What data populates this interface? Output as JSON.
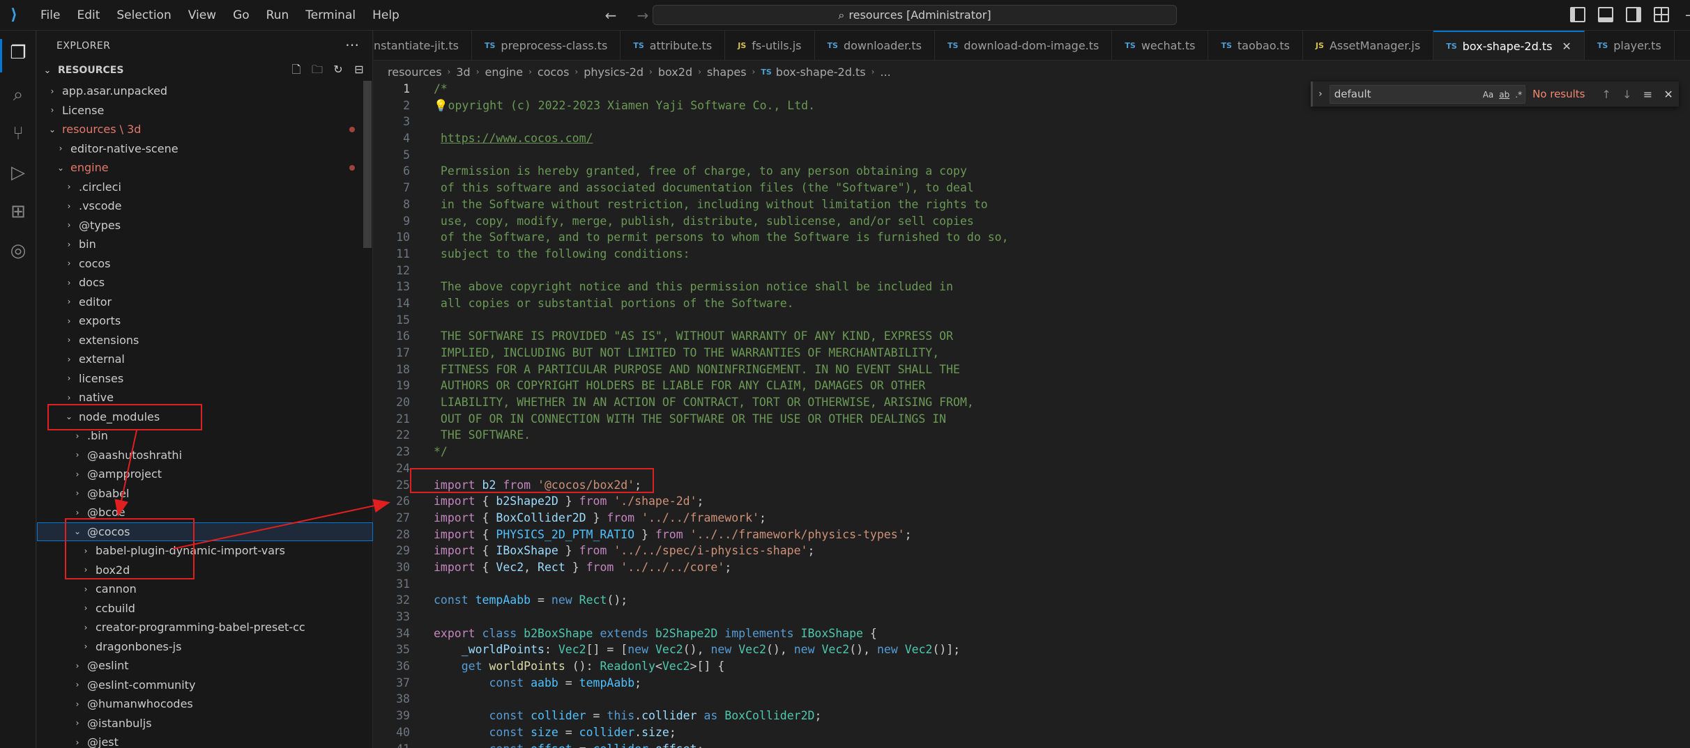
{
  "menu": [
    "File",
    "Edit",
    "Selection",
    "View",
    "Go",
    "Run",
    "Terminal",
    "Help"
  ],
  "command_center": "resources [Administrator]",
  "sidebar": {
    "title": "EXPLORER",
    "root": "RESOURCES",
    "items": [
      {
        "label": "app.asar.unpacked",
        "depth": 0,
        "state": "collapsed"
      },
      {
        "label": "License",
        "depth": 0,
        "state": "collapsed"
      },
      {
        "label": "resources \\ 3d",
        "depth": 0,
        "state": "expanded",
        "modified": true
      },
      {
        "label": "editor-native-scene",
        "depth": 1,
        "state": "collapsed"
      },
      {
        "label": "engine",
        "depth": 1,
        "state": "expanded",
        "modified": true
      },
      {
        "label": ".circleci",
        "depth": 2,
        "state": "collapsed"
      },
      {
        "label": ".vscode",
        "depth": 2,
        "state": "collapsed"
      },
      {
        "label": "@types",
        "depth": 2,
        "state": "collapsed"
      },
      {
        "label": "bin",
        "depth": 2,
        "state": "collapsed"
      },
      {
        "label": "cocos",
        "depth": 2,
        "state": "collapsed"
      },
      {
        "label": "docs",
        "depth": 2,
        "state": "collapsed"
      },
      {
        "label": "editor",
        "depth": 2,
        "state": "collapsed"
      },
      {
        "label": "exports",
        "depth": 2,
        "state": "collapsed"
      },
      {
        "label": "extensions",
        "depth": 2,
        "state": "collapsed"
      },
      {
        "label": "external",
        "depth": 2,
        "state": "collapsed"
      },
      {
        "label": "licenses",
        "depth": 2,
        "state": "collapsed"
      },
      {
        "label": "native",
        "depth": 2,
        "state": "collapsed"
      },
      {
        "label": "node_modules",
        "depth": 2,
        "state": "expanded"
      },
      {
        "label": ".bin",
        "depth": 3,
        "state": "collapsed"
      },
      {
        "label": "@aashutoshrathi",
        "depth": 3,
        "state": "collapsed"
      },
      {
        "label": "@ampproject",
        "depth": 3,
        "state": "collapsed"
      },
      {
        "label": "@babel",
        "depth": 3,
        "state": "collapsed"
      },
      {
        "label": "@bcoe",
        "depth": 3,
        "state": "collapsed"
      },
      {
        "label": "@cocos",
        "depth": 3,
        "state": "expanded",
        "selected": true
      },
      {
        "label": "babel-plugin-dynamic-import-vars",
        "depth": 4,
        "state": "collapsed"
      },
      {
        "label": "box2d",
        "depth": 4,
        "state": "collapsed"
      },
      {
        "label": "cannon",
        "depth": 4,
        "state": "collapsed"
      },
      {
        "label": "ccbuild",
        "depth": 4,
        "state": "collapsed"
      },
      {
        "label": "creator-programming-babel-preset-cc",
        "depth": 4,
        "state": "collapsed"
      },
      {
        "label": "dragonbones-js",
        "depth": 4,
        "state": "collapsed"
      },
      {
        "label": "@eslint",
        "depth": 3,
        "state": "collapsed"
      },
      {
        "label": "@eslint-community",
        "depth": 3,
        "state": "collapsed"
      },
      {
        "label": "@humanwhocodes",
        "depth": 3,
        "state": "collapsed"
      },
      {
        "label": "@istanbuljs",
        "depth": 3,
        "state": "collapsed"
      },
      {
        "label": "@jest",
        "depth": 3,
        "state": "collapsed"
      }
    ]
  },
  "tabs": [
    {
      "label": "nstantiate-jit.ts",
      "type": "",
      "active": false
    },
    {
      "label": "preprocess-class.ts",
      "type": "TS",
      "active": false
    },
    {
      "label": "attribute.ts",
      "type": "TS",
      "active": false
    },
    {
      "label": "fs-utils.js",
      "type": "JS",
      "active": false
    },
    {
      "label": "downloader.ts",
      "type": "TS",
      "active": false
    },
    {
      "label": "download-dom-image.ts",
      "type": "TS",
      "active": false
    },
    {
      "label": "wechat.ts",
      "type": "TS",
      "active": false
    },
    {
      "label": "taobao.ts",
      "type": "TS",
      "active": false
    },
    {
      "label": "AssetManager.js",
      "type": "JS",
      "active": false
    },
    {
      "label": "box-shape-2d.ts",
      "type": "TS",
      "active": true
    },
    {
      "label": "player.ts",
      "type": "TS",
      "active": false
    }
  ],
  "breadcrumbs": [
    "resources",
    "3d",
    "engine",
    "cocos",
    "physics-2d",
    "box2d",
    "shapes"
  ],
  "breadcrumb_file": "box-shape-2d.ts",
  "breadcrumb_tail": "...",
  "find": {
    "value": "default",
    "opt_case": "Aa",
    "opt_word": "ab",
    "opt_regex": ".*",
    "result": "No results"
  },
  "code_lines": [
    [
      [
        "c-com",
        "/*"
      ]
    ],
    [
      [
        "bulb",
        "💡"
      ],
      [
        "c-com",
        "opyright (c) 2022-2023 Xiamen Yaji Software Co., Ltd."
      ]
    ],
    [],
    [
      [
        "c-com",
        " "
      ],
      [
        "c-link",
        "https://www.cocos.com/"
      ]
    ],
    [],
    [
      [
        "c-com",
        " Permission is hereby granted, free of charge, to any person obtaining a copy"
      ]
    ],
    [
      [
        "c-com",
        " of this software and associated documentation files (the \"Software\"), to deal"
      ]
    ],
    [
      [
        "c-com",
        " in the Software without restriction, including without limitation the rights to"
      ]
    ],
    [
      [
        "c-com",
        " use, copy, modify, merge, publish, distribute, sublicense, and/or sell copies"
      ]
    ],
    [
      [
        "c-com",
        " of the Software, and to permit persons to whom the Software is furnished to do so,"
      ]
    ],
    [
      [
        "c-com",
        " subject to the following conditions:"
      ]
    ],
    [],
    [
      [
        "c-com",
        " The above copyright notice and this permission notice shall be included in"
      ]
    ],
    [
      [
        "c-com",
        " all copies or substantial portions of the Software."
      ]
    ],
    [],
    [
      [
        "c-com",
        " THE SOFTWARE IS PROVIDED \"AS IS\", WITHOUT WARRANTY OF ANY KIND, EXPRESS OR"
      ]
    ],
    [
      [
        "c-com",
        " IMPLIED, INCLUDING BUT NOT LIMITED TO THE WARRANTIES OF MERCHANTABILITY,"
      ]
    ],
    [
      [
        "c-com",
        " FITNESS FOR A PARTICULAR PURPOSE AND NONINFRINGEMENT. IN NO EVENT SHALL THE"
      ]
    ],
    [
      [
        "c-com",
        " AUTHORS OR COPYRIGHT HOLDERS BE LIABLE FOR ANY CLAIM, DAMAGES OR OTHER"
      ]
    ],
    [
      [
        "c-com",
        " LIABILITY, WHETHER IN AN ACTION OF CONTRACT, TORT OR OTHERWISE, ARISING FROM,"
      ]
    ],
    [
      [
        "c-com",
        " OUT OF OR IN CONNECTION WITH THE SOFTWARE OR THE USE OR OTHER DEALINGS IN"
      ]
    ],
    [
      [
        "c-com",
        " THE SOFTWARE."
      ]
    ],
    [
      [
        "c-com",
        "*/"
      ]
    ],
    [],
    [
      [
        "c-kw",
        "import"
      ],
      [
        "c-pun",
        " "
      ],
      [
        "c-var",
        "b2"
      ],
      [
        "c-pun",
        " "
      ],
      [
        "c-kw",
        "from"
      ],
      [
        "c-pun",
        " "
      ],
      [
        "c-str",
        "'@cocos/box2d'"
      ],
      [
        "c-pun",
        ";"
      ]
    ],
    [
      [
        "c-kw",
        "import"
      ],
      [
        "c-pun",
        " { "
      ],
      [
        "c-var",
        "b2Shape2D"
      ],
      [
        "c-pun",
        " } "
      ],
      [
        "c-kw",
        "from"
      ],
      [
        "c-pun",
        " "
      ],
      [
        "c-str",
        "'./shape-2d'"
      ],
      [
        "c-pun",
        ";"
      ]
    ],
    [
      [
        "c-kw",
        "import"
      ],
      [
        "c-pun",
        " { "
      ],
      [
        "c-var",
        "BoxCollider2D"
      ],
      [
        "c-pun",
        " } "
      ],
      [
        "c-kw",
        "from"
      ],
      [
        "c-pun",
        " "
      ],
      [
        "c-str",
        "'../../framework'"
      ],
      [
        "c-pun",
        ";"
      ]
    ],
    [
      [
        "c-kw",
        "import"
      ],
      [
        "c-pun",
        " { "
      ],
      [
        "c-const",
        "PHYSICS_2D_PTM_RATIO"
      ],
      [
        "c-pun",
        " } "
      ],
      [
        "c-kw",
        "from"
      ],
      [
        "c-pun",
        " "
      ],
      [
        "c-str",
        "'../../framework/physics-types'"
      ],
      [
        "c-pun",
        ";"
      ]
    ],
    [
      [
        "c-kw",
        "import"
      ],
      [
        "c-pun",
        " { "
      ],
      [
        "c-var",
        "IBoxShape"
      ],
      [
        "c-pun",
        " } "
      ],
      [
        "c-kw",
        "from"
      ],
      [
        "c-pun",
        " "
      ],
      [
        "c-str",
        "'../../spec/i-physics-shape'"
      ],
      [
        "c-pun",
        ";"
      ]
    ],
    [
      [
        "c-kw",
        "import"
      ],
      [
        "c-pun",
        " { "
      ],
      [
        "c-var",
        "Vec2"
      ],
      [
        "c-pun",
        ", "
      ],
      [
        "c-var",
        "Rect"
      ],
      [
        "c-pun",
        " } "
      ],
      [
        "c-kw",
        "from"
      ],
      [
        "c-pun",
        " "
      ],
      [
        "c-str",
        "'../../../core'"
      ],
      [
        "c-pun",
        ";"
      ]
    ],
    [],
    [
      [
        "c-kw2",
        "const"
      ],
      [
        "c-pun",
        " "
      ],
      [
        "c-const",
        "tempAabb"
      ],
      [
        "c-pun",
        " = "
      ],
      [
        "c-kw2",
        "new"
      ],
      [
        "c-pun",
        " "
      ],
      [
        "c-cls",
        "Rect"
      ],
      [
        "c-pun",
        "();"
      ]
    ],
    [],
    [
      [
        "c-kw",
        "export"
      ],
      [
        "c-pun",
        " "
      ],
      [
        "c-kw2",
        "class"
      ],
      [
        "c-pun",
        " "
      ],
      [
        "c-cls",
        "b2BoxShape"
      ],
      [
        "c-pun",
        " "
      ],
      [
        "c-kw2",
        "extends"
      ],
      [
        "c-pun",
        " "
      ],
      [
        "c-cls",
        "b2Shape2D"
      ],
      [
        "c-pun",
        " "
      ],
      [
        "c-kw2",
        "implements"
      ],
      [
        "c-pun",
        " "
      ],
      [
        "c-cls",
        "IBoxShape"
      ],
      [
        "c-pun",
        " {"
      ]
    ],
    [
      [
        "c-pun",
        "    "
      ],
      [
        "c-var",
        "_worldPoints"
      ],
      [
        "c-pun",
        ": "
      ],
      [
        "c-cls",
        "Vec2"
      ],
      [
        "c-pun",
        "[] = ["
      ],
      [
        "c-kw2",
        "new"
      ],
      [
        "c-pun",
        " "
      ],
      [
        "c-cls",
        "Vec2"
      ],
      [
        "c-pun",
        "(), "
      ],
      [
        "c-kw2",
        "new"
      ],
      [
        "c-pun",
        " "
      ],
      [
        "c-cls",
        "Vec2"
      ],
      [
        "c-pun",
        "(), "
      ],
      [
        "c-kw2",
        "new"
      ],
      [
        "c-pun",
        " "
      ],
      [
        "c-cls",
        "Vec2"
      ],
      [
        "c-pun",
        "(), "
      ],
      [
        "c-kw2",
        "new"
      ],
      [
        "c-pun",
        " "
      ],
      [
        "c-cls",
        "Vec2"
      ],
      [
        "c-pun",
        "()];"
      ]
    ],
    [
      [
        "c-pun",
        "    "
      ],
      [
        "c-kw2",
        "get"
      ],
      [
        "c-pun",
        " "
      ],
      [
        "c-fn",
        "worldPoints"
      ],
      [
        "c-pun",
        " (): "
      ],
      [
        "c-cls",
        "Readonly"
      ],
      [
        "c-pun",
        "<"
      ],
      [
        "c-cls",
        "Vec2"
      ],
      [
        "c-pun",
        ">[] {"
      ]
    ],
    [
      [
        "c-pun",
        "        "
      ],
      [
        "c-kw2",
        "const"
      ],
      [
        "c-pun",
        " "
      ],
      [
        "c-const",
        "aabb"
      ],
      [
        "c-pun",
        " = "
      ],
      [
        "c-const",
        "tempAabb"
      ],
      [
        "c-pun",
        ";"
      ]
    ],
    [],
    [
      [
        "c-pun",
        "        "
      ],
      [
        "c-kw2",
        "const"
      ],
      [
        "c-pun",
        " "
      ],
      [
        "c-const",
        "collider"
      ],
      [
        "c-pun",
        " = "
      ],
      [
        "c-kw2",
        "this"
      ],
      [
        "c-pun",
        "."
      ],
      [
        "c-var",
        "collider"
      ],
      [
        "c-pun",
        " "
      ],
      [
        "c-kw2",
        "as"
      ],
      [
        "c-pun",
        " "
      ],
      [
        "c-cls",
        "BoxCollider2D"
      ],
      [
        "c-pun",
        ";"
      ]
    ],
    [
      [
        "c-pun",
        "        "
      ],
      [
        "c-kw2",
        "const"
      ],
      [
        "c-pun",
        " "
      ],
      [
        "c-const",
        "size"
      ],
      [
        "c-pun",
        " = "
      ],
      [
        "c-const",
        "collider"
      ],
      [
        "c-pun",
        "."
      ],
      [
        "c-var",
        "size"
      ],
      [
        "c-pun",
        ";"
      ]
    ],
    [
      [
        "c-pun",
        "        "
      ],
      [
        "c-kw2",
        "const"
      ],
      [
        "c-pun",
        " "
      ],
      [
        "c-const",
        "offset"
      ],
      [
        "c-pun",
        " = "
      ],
      [
        "c-const",
        "collider"
      ],
      [
        "c-pun",
        "."
      ],
      [
        "c-var",
        "offset"
      ],
      [
        "c-pun",
        ";"
      ]
    ]
  ],
  "current_line": 1
}
